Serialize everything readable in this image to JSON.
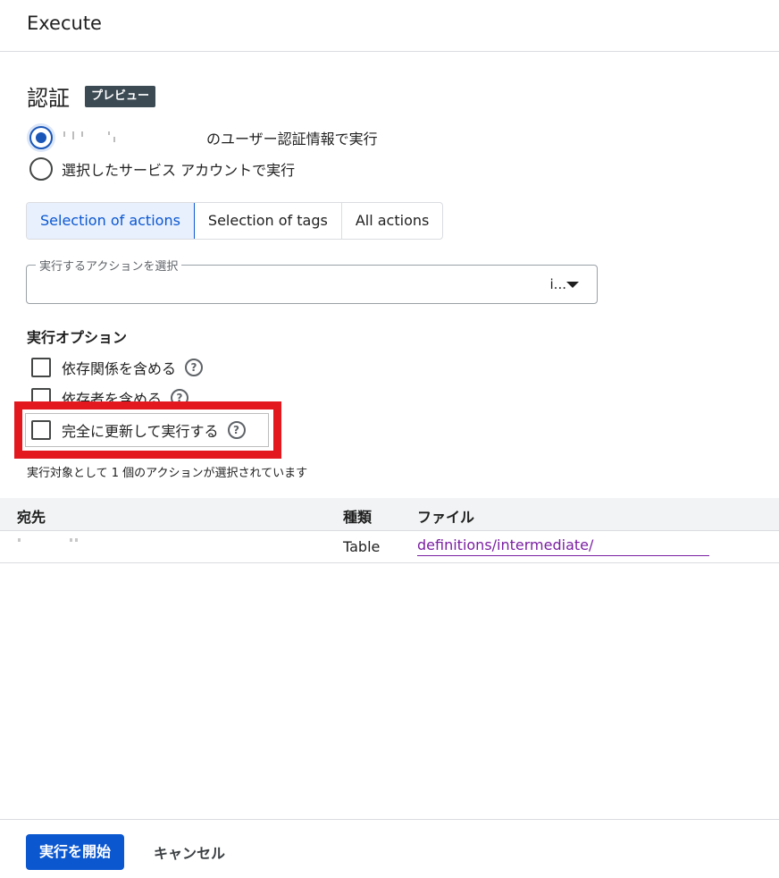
{
  "header": {
    "title": "Execute"
  },
  "auth": {
    "title": "認証",
    "badge": "プレビュー",
    "option_user_suffix": "のユーザー認証情報で実行",
    "option_service": "選択したサービス アカウントで実行",
    "selected": "user"
  },
  "selection_tabs": [
    {
      "label": "Selection of actions",
      "active": true
    },
    {
      "label": "Selection of tags",
      "active": false
    },
    {
      "label": "All actions",
      "active": false
    }
  ],
  "action_select": {
    "label": "実行するアクションを選択",
    "value": "i..."
  },
  "run_options": {
    "title": "実行オプション",
    "items": [
      {
        "label": "依存関係を含める",
        "checked": false
      },
      {
        "label": "依存者を含める",
        "checked": false
      },
      {
        "label": "完全に更新して実行する",
        "checked": false
      }
    ]
  },
  "selection_count": "実行対象として 1 個のアクションが選択されています",
  "table": {
    "headers": [
      "宛先",
      "種類",
      "ファイル"
    ],
    "rows": [
      {
        "destination": "",
        "type": "Table",
        "file": "definitions/intermediate/"
      }
    ]
  },
  "footer": {
    "start_label": "実行を開始",
    "cancel_label": "キャンセル"
  },
  "colors": {
    "accent": "#0b57d0",
    "highlight": "#e3181e",
    "link": "#7b1fa2",
    "badge_bg": "#3c4a54"
  },
  "icons": [
    "help-icon",
    "dropdown-arrow-icon",
    "radio-icon",
    "checkbox-icon"
  ]
}
